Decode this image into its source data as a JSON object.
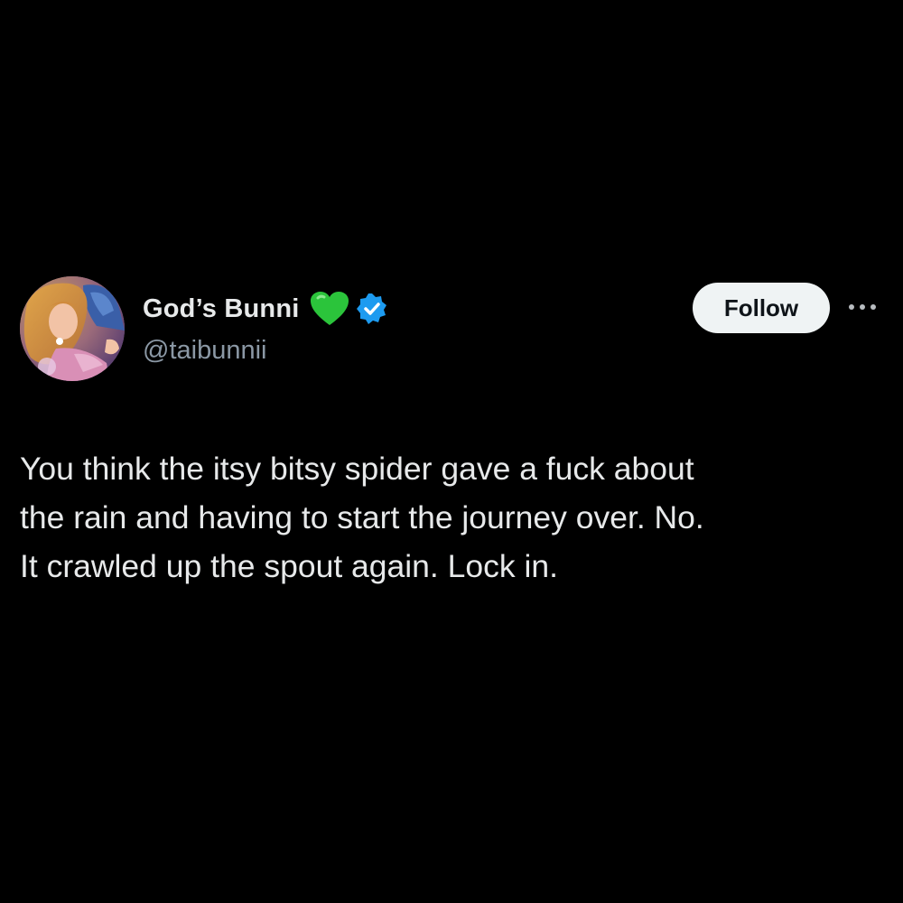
{
  "author": {
    "display_name": "God’s Bunni",
    "handle": "@taibunnii",
    "emoji": "green-heart-icon",
    "verified_badge": "verified-icon"
  },
  "actions": {
    "follow_label": "Follow",
    "more_icon": "more-horizontal-icon"
  },
  "tweet": {
    "text": "You think the itsy bitsy spider gave a fuck about\nthe rain and having to start the journey over. No.\nIt crawled up the spout again. Lock in."
  },
  "colors": {
    "background": "#000000",
    "primary_text": "#e7e9ea",
    "secondary_text": "#8b98a5",
    "verified_blue": "#1d9bf0",
    "heart_green": "#2bc43b",
    "follow_bg": "#eff3f4"
  }
}
